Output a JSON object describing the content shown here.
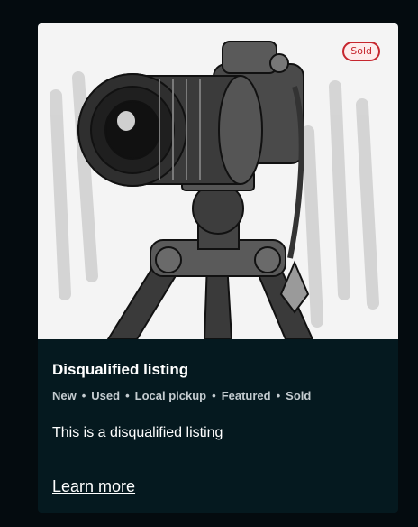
{
  "card": {
    "badge": "Sold",
    "title": "Disqualified listing",
    "tags": [
      "New",
      "Used",
      "Local pickup",
      "Featured",
      "Sold"
    ],
    "separator": "•",
    "description": "This is a disqualified listing",
    "link_label": "Learn more",
    "image_icon": "camera-on-tripod-illustration"
  },
  "colors": {
    "page_background": "#040b0f",
    "card_background": "#05191f",
    "badge_border": "#c6262e",
    "badge_text": "#c6262e",
    "title_text": "#ffffff",
    "tag_text": "#c4ccd0"
  }
}
